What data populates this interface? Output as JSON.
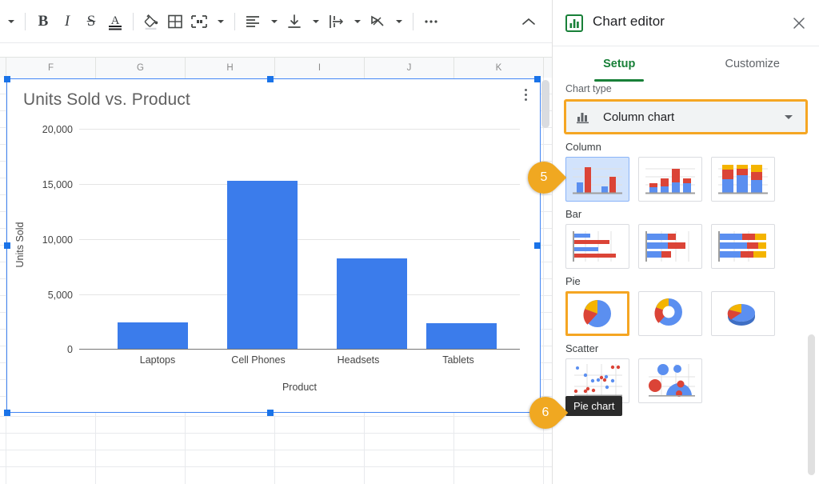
{
  "toolbar": {
    "items": [
      {
        "name": "font-size-dropdown-caret",
        "glyph": "▾"
      },
      {
        "name": "bold-button",
        "glyph": "B"
      },
      {
        "name": "italic-button",
        "glyph": "I"
      },
      {
        "name": "strikethrough-button",
        "glyph": "S"
      },
      {
        "name": "text-color-button",
        "glyph": "A"
      },
      {
        "name": "fill-color-button",
        "glyph": "fill"
      },
      {
        "name": "borders-button",
        "glyph": "borders"
      },
      {
        "name": "merge-cells-button",
        "glyph": "merge"
      },
      {
        "name": "horizontal-align-button",
        "glyph": "align"
      },
      {
        "name": "vertical-align-button",
        "glyph": "valign"
      },
      {
        "name": "text-wrapping-button",
        "glyph": "wrap"
      },
      {
        "name": "text-rotation-button",
        "glyph": "rotate"
      },
      {
        "name": "more-options-button",
        "glyph": "…"
      },
      {
        "name": "collapse-toolbar-button",
        "glyph": "^"
      }
    ]
  },
  "spreadsheet": {
    "column_headers": [
      "F",
      "G",
      "H",
      "I",
      "J",
      "K"
    ]
  },
  "chart": {
    "menu_name": "chart-options-menu"
  },
  "chart_data": {
    "type": "bar",
    "title": "Units Sold vs. Product",
    "xlabel": "Product",
    "ylabel": "Units Sold",
    "categories": [
      "Laptops",
      "Cell Phones",
      "Headsets",
      "Tablets"
    ],
    "values": [
      2400,
      15200,
      8200,
      2350
    ],
    "ytick_labels": [
      "20,000",
      "15,000",
      "10,000",
      "5,000",
      "0"
    ],
    "ytick_values": [
      20000,
      15000,
      10000,
      5000,
      0
    ],
    "ylim": [
      0,
      20000
    ],
    "grid": true,
    "legend": "none",
    "bar_color": "#3b7ceb"
  },
  "editor": {
    "title": "Chart editor",
    "icon": "bar-chart-icon",
    "close_label": "✕",
    "tabs": [
      {
        "label": "Setup",
        "active": true
      },
      {
        "label": "Customize",
        "active": false
      }
    ],
    "chart_type_label": "Chart type",
    "selected_chart_type": "Column chart",
    "groups": [
      {
        "title": "Column",
        "thumbs": [
          "clustered-column",
          "stacked-column",
          "100-percent-stacked-column"
        ]
      },
      {
        "title": "Bar",
        "thumbs": [
          "clustered-bar",
          "stacked-bar",
          "100-percent-stacked-bar"
        ]
      },
      {
        "title": "Pie",
        "thumbs": [
          "pie-chart",
          "doughnut-chart",
          "3d-pie-chart"
        ]
      },
      {
        "title": "Scatter",
        "thumbs": [
          "scatter-chart",
          "bubble-chart"
        ]
      }
    ],
    "tooltip": "Pie chart"
  },
  "callouts": [
    {
      "number": "5"
    },
    {
      "number": "6"
    }
  ],
  "colors": {
    "accent_blue": "#1a73e8",
    "bar_blue": "#3b7ceb",
    "highlight_orange": "#f5a623",
    "pin_orange": "#f0a821",
    "tab_green": "#188038"
  }
}
